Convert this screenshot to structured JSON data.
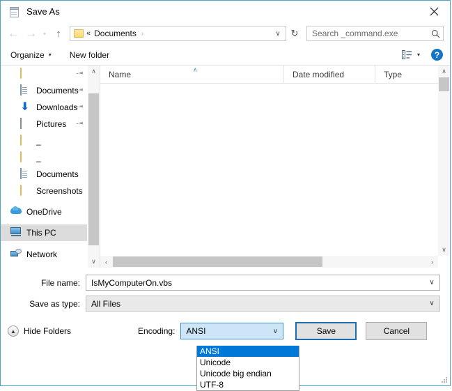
{
  "window": {
    "title": "Save As",
    "icon": "notepad-icon",
    "close_label": "✕",
    "accent_border": "#4ea3c8"
  },
  "nav": {
    "back": "←",
    "forward": "→",
    "recent_dot": "▾",
    "up": "↑",
    "refresh": "↻",
    "address": {
      "chevron": "«",
      "crumb": "Documents",
      "separator": "›",
      "caret": "∨"
    },
    "search": {
      "placeholder": "Search _command.exe",
      "icon": "search-icon"
    }
  },
  "toolbar": {
    "organize_label": "Organize",
    "organize_caret": "▾",
    "new_folder_label": "New folder",
    "view_caret": "▾",
    "help_label": "?"
  },
  "sidebar": {
    "items": [
      {
        "label": "",
        "icon": "folder-icon",
        "pinned": true,
        "selected": false
      },
      {
        "label": "Documents",
        "icon": "documents-icon",
        "pinned": true,
        "selected": false
      },
      {
        "label": "Downloads",
        "icon": "downloads-icon",
        "pinned": true,
        "selected": false
      },
      {
        "label": "Pictures",
        "icon": "pictures-icon",
        "pinned": true,
        "selected": false
      },
      {
        "label": "_",
        "icon": "folder-icon",
        "pinned": false,
        "selected": false
      },
      {
        "label": "_",
        "icon": "folder-icon",
        "pinned": false,
        "selected": false
      },
      {
        "label": "Documents",
        "icon": "documents-icon",
        "pinned": false,
        "selected": false
      },
      {
        "label": "Screenshots",
        "icon": "folder-icon",
        "pinned": false,
        "selected": false
      },
      {
        "label": "OneDrive",
        "icon": "onedrive-icon",
        "pinned": false,
        "selected": false
      },
      {
        "label": "This PC",
        "icon": "this-pc-icon",
        "pinned": false,
        "selected": true
      },
      {
        "label": "Network",
        "icon": "network-icon",
        "pinned": false,
        "selected": false
      }
    ],
    "scroll_up": "∧",
    "scroll_down": "∨",
    "pin_glyph": "📌"
  },
  "filepane": {
    "columns": [
      {
        "label": "Name",
        "sorted": true,
        "sort_caret": "∧"
      },
      {
        "label": "Date modified",
        "sorted": false,
        "sort_caret": ""
      },
      {
        "label": "Type",
        "sorted": false,
        "sort_caret": ""
      }
    ],
    "rows": [],
    "hscroll_left": "‹",
    "hscroll_right": "›",
    "vscroll_up": "∧",
    "vscroll_down": "∨"
  },
  "form": {
    "filename_label": "File name:",
    "filename_value": "IsMyComputerOn.vbs",
    "filetype_label": "Save as type:",
    "filetype_value": "All Files",
    "caret": "∨"
  },
  "actions": {
    "hide_folders_label": "Hide Folders",
    "hide_folders_icon": "circle-up-icon",
    "hide_folders_caret": "▲",
    "encoding_label": "Encoding:",
    "encoding_value": "ANSI",
    "encoding_caret": "∨",
    "save_label": "Save",
    "cancel_label": "Cancel"
  },
  "encoding_dropdown": {
    "open": true,
    "selected_index": 0,
    "highlight_color": "#0078d7",
    "options": [
      "ANSI",
      "Unicode",
      "Unicode big endian",
      "UTF-8"
    ]
  }
}
